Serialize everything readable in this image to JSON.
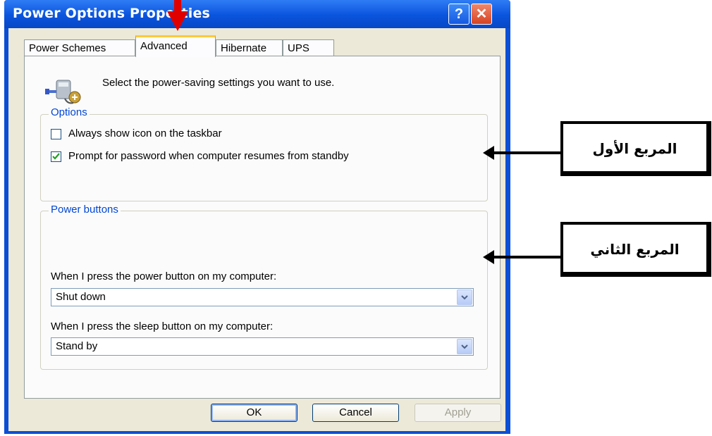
{
  "window": {
    "title": "Power Options Properties",
    "help_label": "?",
    "close_label": "✕"
  },
  "tabs": [
    {
      "label": "Power Schemes"
    },
    {
      "label": "Advanced"
    },
    {
      "label": "Hibernate"
    },
    {
      "label": "UPS"
    }
  ],
  "intro_text": "Select the power-saving settings you want to use.",
  "options": {
    "title": "Options",
    "items": [
      {
        "label": "Always show icon on the taskbar",
        "checked": false
      },
      {
        "label": "Prompt for password when computer resumes from standby",
        "checked": true
      }
    ]
  },
  "power_buttons": {
    "title": "Power buttons",
    "power_label": "When I press the power button on my computer:",
    "power_value": "Shut down",
    "sleep_label": "When I press the sleep button on my computer:",
    "sleep_value": "Stand by"
  },
  "buttons": {
    "ok": "OK",
    "cancel": "Cancel",
    "apply": "Apply"
  },
  "annotations": {
    "box1": "المربع الأول",
    "box2": "المربع الثاني"
  },
  "colors": {
    "title_bar": "#0a54dd",
    "group_title": "#0046d5",
    "tab_highlight": "#ffc83c",
    "annotation_arrow": "#e00000"
  },
  "icons": [
    "power-options-icon",
    "help-icon",
    "close-icon",
    "checkmark-icon",
    "chevron-down-icon"
  ]
}
